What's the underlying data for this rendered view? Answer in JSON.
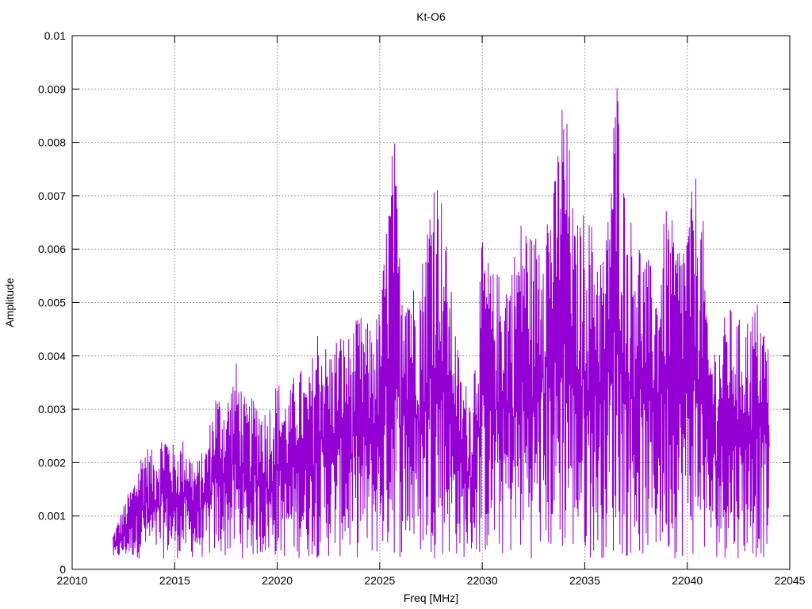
{
  "chart_data": {
    "type": "line",
    "title": "Kt-O6",
    "xlabel": "Freq [MHz]",
    "ylabel": "Amplitude",
    "xlim": [
      22010,
      22045
    ],
    "ylim": [
      0,
      0.01
    ],
    "x_ticks": [
      "22010",
      "22015",
      "22020",
      "22025",
      "22030",
      "22035",
      "22040",
      "22045"
    ],
    "y_ticks": [
      "0",
      "0.001",
      "0.002",
      "0.003",
      "0.004",
      "0.005",
      "0.006",
      "0.007",
      "0.008",
      "0.009",
      "0.01"
    ],
    "grid": true,
    "legend": "none",
    "color": "#9400d3",
    "series": [
      {
        "x_start": 22012.0,
        "x_end": 22044.0,
        "points_approx": 1600,
        "envelope_max": [
          [
            22012.0,
            0.0007
          ],
          [
            22012.5,
            0.0012
          ],
          [
            22013.0,
            0.0017
          ],
          [
            22013.5,
            0.0024
          ],
          [
            22014.0,
            0.0022
          ],
          [
            22014.5,
            0.0027
          ],
          [
            22015.0,
            0.0023
          ],
          [
            22015.5,
            0.0025
          ],
          [
            22016.0,
            0.002
          ],
          [
            22016.5,
            0.0023
          ],
          [
            22017.0,
            0.0034
          ],
          [
            22017.5,
            0.0032
          ],
          [
            22018.0,
            0.0039
          ],
          [
            22018.5,
            0.0031
          ],
          [
            22019.0,
            0.0033
          ],
          [
            22019.5,
            0.003
          ],
          [
            22020.0,
            0.0036
          ],
          [
            22020.5,
            0.0032
          ],
          [
            22021.0,
            0.0039
          ],
          [
            22021.5,
            0.0035
          ],
          [
            22022.0,
            0.0047
          ],
          [
            22022.5,
            0.0041
          ],
          [
            22023.0,
            0.0045
          ],
          [
            22023.5,
            0.0044
          ],
          [
            22024.0,
            0.0048
          ],
          [
            22024.5,
            0.0046
          ],
          [
            22025.0,
            0.0049
          ],
          [
            22025.5,
            0.0074
          ],
          [
            22025.7,
            0.0083
          ],
          [
            22026.0,
            0.0058
          ],
          [
            22026.3,
            0.0063
          ],
          [
            22026.6,
            0.0054
          ],
          [
            22027.0,
            0.0057
          ],
          [
            22027.3,
            0.0065
          ],
          [
            22027.6,
            0.0079
          ],
          [
            22028.0,
            0.0071
          ],
          [
            22028.5,
            0.0052
          ],
          [
            22029.0,
            0.0036
          ],
          [
            22029.5,
            0.0034
          ],
          [
            22030.0,
            0.0062
          ],
          [
            22030.5,
            0.0056
          ],
          [
            22031.0,
            0.0056
          ],
          [
            22031.5,
            0.0059
          ],
          [
            22032.0,
            0.0068
          ],
          [
            22032.5,
            0.0062
          ],
          [
            22033.0,
            0.0071
          ],
          [
            22033.5,
            0.0072
          ],
          [
            22033.9,
            0.009
          ],
          [
            22034.2,
            0.0083
          ],
          [
            22034.5,
            0.0064
          ],
          [
            22035.0,
            0.0068
          ],
          [
            22035.5,
            0.0064
          ],
          [
            22036.0,
            0.0059
          ],
          [
            22036.3,
            0.0082
          ],
          [
            22036.6,
            0.0094
          ],
          [
            22037.0,
            0.0068
          ],
          [
            22037.5,
            0.0065
          ],
          [
            22038.0,
            0.0059
          ],
          [
            22038.5,
            0.0055
          ],
          [
            22039.0,
            0.0069
          ],
          [
            22039.5,
            0.0062
          ],
          [
            22040.0,
            0.0066
          ],
          [
            22040.4,
            0.0075
          ],
          [
            22040.8,
            0.0065
          ],
          [
            22041.0,
            0.0044
          ],
          [
            22041.5,
            0.0043
          ],
          [
            22042.0,
            0.005
          ],
          [
            22042.5,
            0.0047
          ],
          [
            22043.0,
            0.0048
          ],
          [
            22043.5,
            0.0051
          ],
          [
            22044.0,
            0.0042
          ]
        ],
        "envelope_min_approx": 0.0002
      }
    ]
  }
}
